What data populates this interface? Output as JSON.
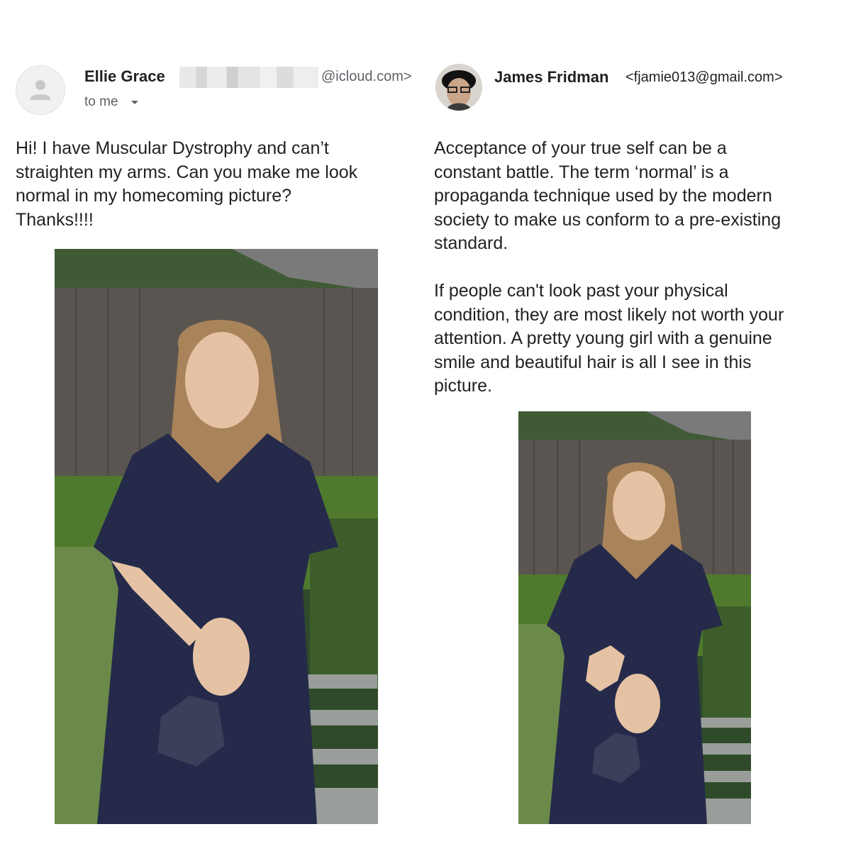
{
  "left_email": {
    "sender_name": "Ellie Grace",
    "sender_domain": "@icloud.com>",
    "recipient": "to me",
    "body_lines": [
      "Hi! I have Muscular Dystrophy and can’t",
      "straighten my arms. Can you make me look",
      "normal in my homecoming picture?",
      "Thanks!!!!"
    ]
  },
  "right_email": {
    "sender_name": "James Fridman",
    "sender_email": "<fjamie013@gmail.com>",
    "paragraph1_lines": [
      "Acceptance of your true self can be a",
      "constant battle. The term ‘normal’ is a",
      "propaganda technique used by the modern",
      "society to make us conform to a pre-existing",
      "standard."
    ],
    "paragraph2_lines": [
      "If people can't look past your physical",
      "condition, they are most likely not worth your",
      "attention. A pretty young girl with a genuine",
      "smile and beautiful hair is all I see in this",
      "picture."
    ]
  },
  "icons": {
    "default_avatar": "person-silhouette-icon",
    "dropdown": "caret-down-icon"
  },
  "colors": {
    "dress": "#252a4a",
    "hair": "#a9835a",
    "lawn": "#4f7a2e",
    "fence": "#5a5550",
    "foliage": "#2f4a2a"
  }
}
